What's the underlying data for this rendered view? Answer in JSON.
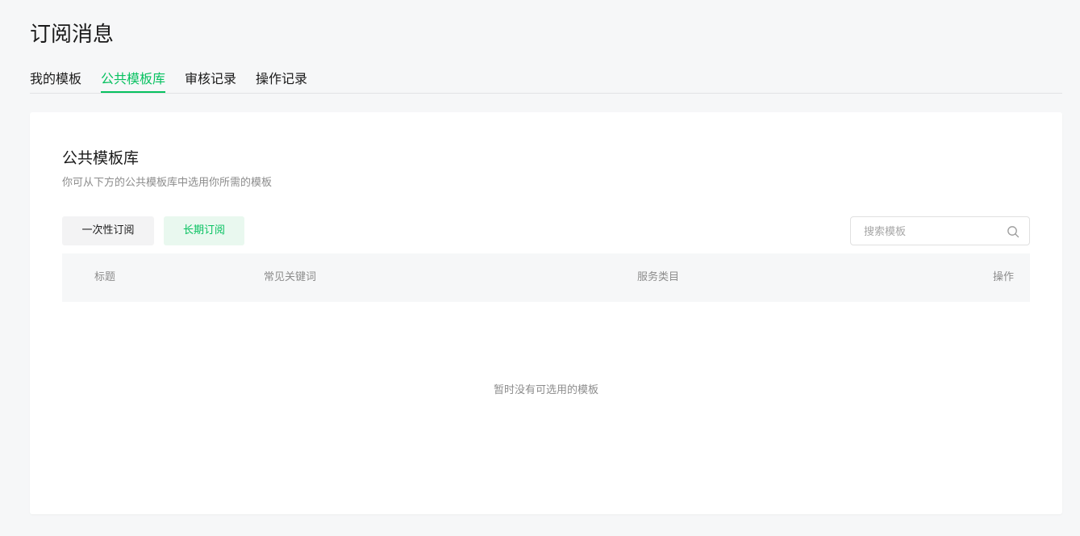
{
  "page": {
    "title": "订阅消息"
  },
  "tabs": [
    {
      "label": "我的模板",
      "active": false
    },
    {
      "label": "公共模板库",
      "active": true
    },
    {
      "label": "审核记录",
      "active": false
    },
    {
      "label": "操作记录",
      "active": false
    }
  ],
  "card": {
    "title": "公共模板库",
    "description": "你可从下方的公共模板库中选用你所需的模板"
  },
  "filters": {
    "once_label": "一次性订阅",
    "long_label": "长期订阅",
    "active": "long"
  },
  "search": {
    "placeholder": "搜索模板",
    "value": ""
  },
  "table": {
    "columns": [
      "标题",
      "常见关键词",
      "服务类目",
      "操作"
    ],
    "rows": [],
    "empty_text": "暂时没有可选用的模板"
  },
  "colors": {
    "accent": "#07c160",
    "accent_bg": "#e9f8ef",
    "muted": "#8c8c8c",
    "background": "#f6f7f8"
  },
  "icons": {
    "search": "search-icon"
  }
}
